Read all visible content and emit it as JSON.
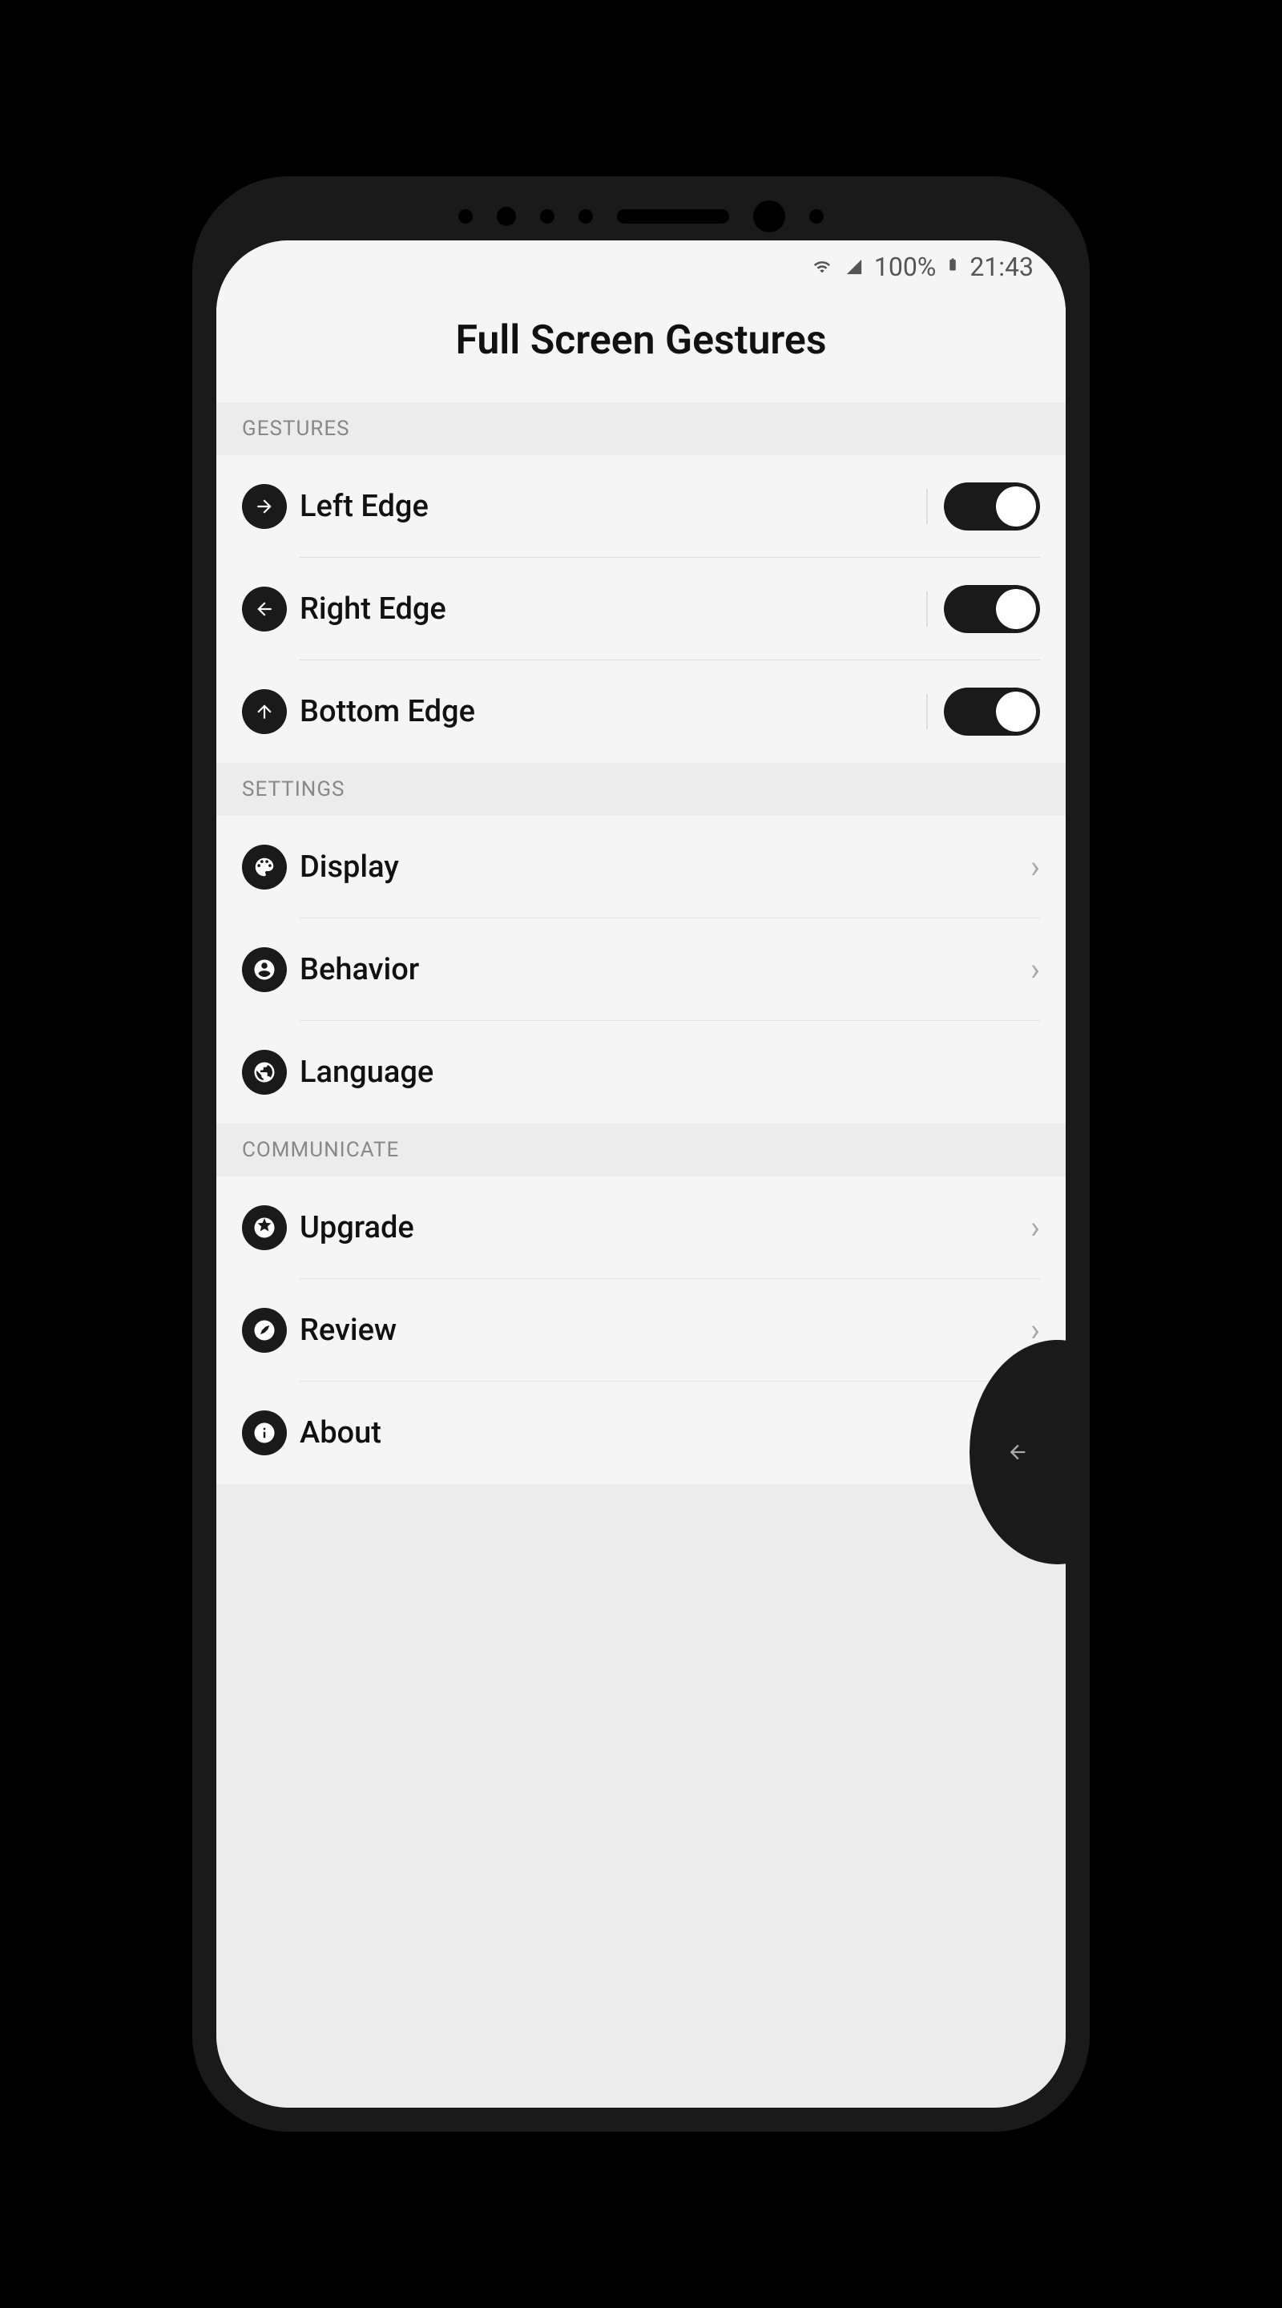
{
  "status": {
    "battery": "100%",
    "time": "21:43"
  },
  "header": {
    "title": "Full Screen Gestures"
  },
  "sections": {
    "gestures": {
      "title": "GESTURES",
      "items": [
        {
          "label": "Left Edge",
          "toggle": true
        },
        {
          "label": "Right Edge",
          "toggle": true
        },
        {
          "label": "Bottom Edge",
          "toggle": true
        }
      ]
    },
    "settings": {
      "title": "SETTINGS",
      "items": [
        {
          "label": "Display",
          "chevron": true
        },
        {
          "label": "Behavior",
          "chevron": true
        },
        {
          "label": "Language",
          "chevron": false
        }
      ]
    },
    "communicate": {
      "title": "COMMUNICATE",
      "items": [
        {
          "label": "Upgrade",
          "chevron": true
        },
        {
          "label": "Review",
          "chevron": true
        },
        {
          "label": "About",
          "chevron": true
        }
      ]
    }
  }
}
